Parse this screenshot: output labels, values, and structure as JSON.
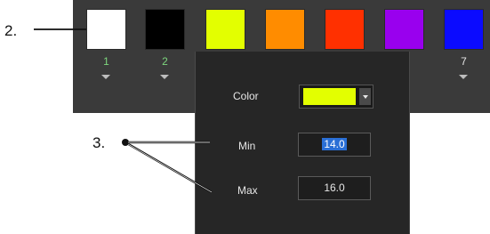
{
  "callouts": {
    "two": "2.",
    "three": "3."
  },
  "swatches": [
    {
      "color": "#ffffff",
      "number": "1"
    },
    {
      "color": "#000000",
      "number": "2"
    },
    {
      "color": "#e3ff00",
      "number": ""
    },
    {
      "color": "#ff8c00",
      "number": ""
    },
    {
      "color": "#ff3000",
      "number": ""
    },
    {
      "color": "#9900ee",
      "number": ""
    },
    {
      "color": "#0b0bff",
      "number": "7"
    }
  ],
  "popup": {
    "color_label": "Color",
    "color_value": "#e3ff00",
    "min_label": "Min",
    "min_value": "14.0",
    "max_label": "Max",
    "max_value": "16.0"
  }
}
